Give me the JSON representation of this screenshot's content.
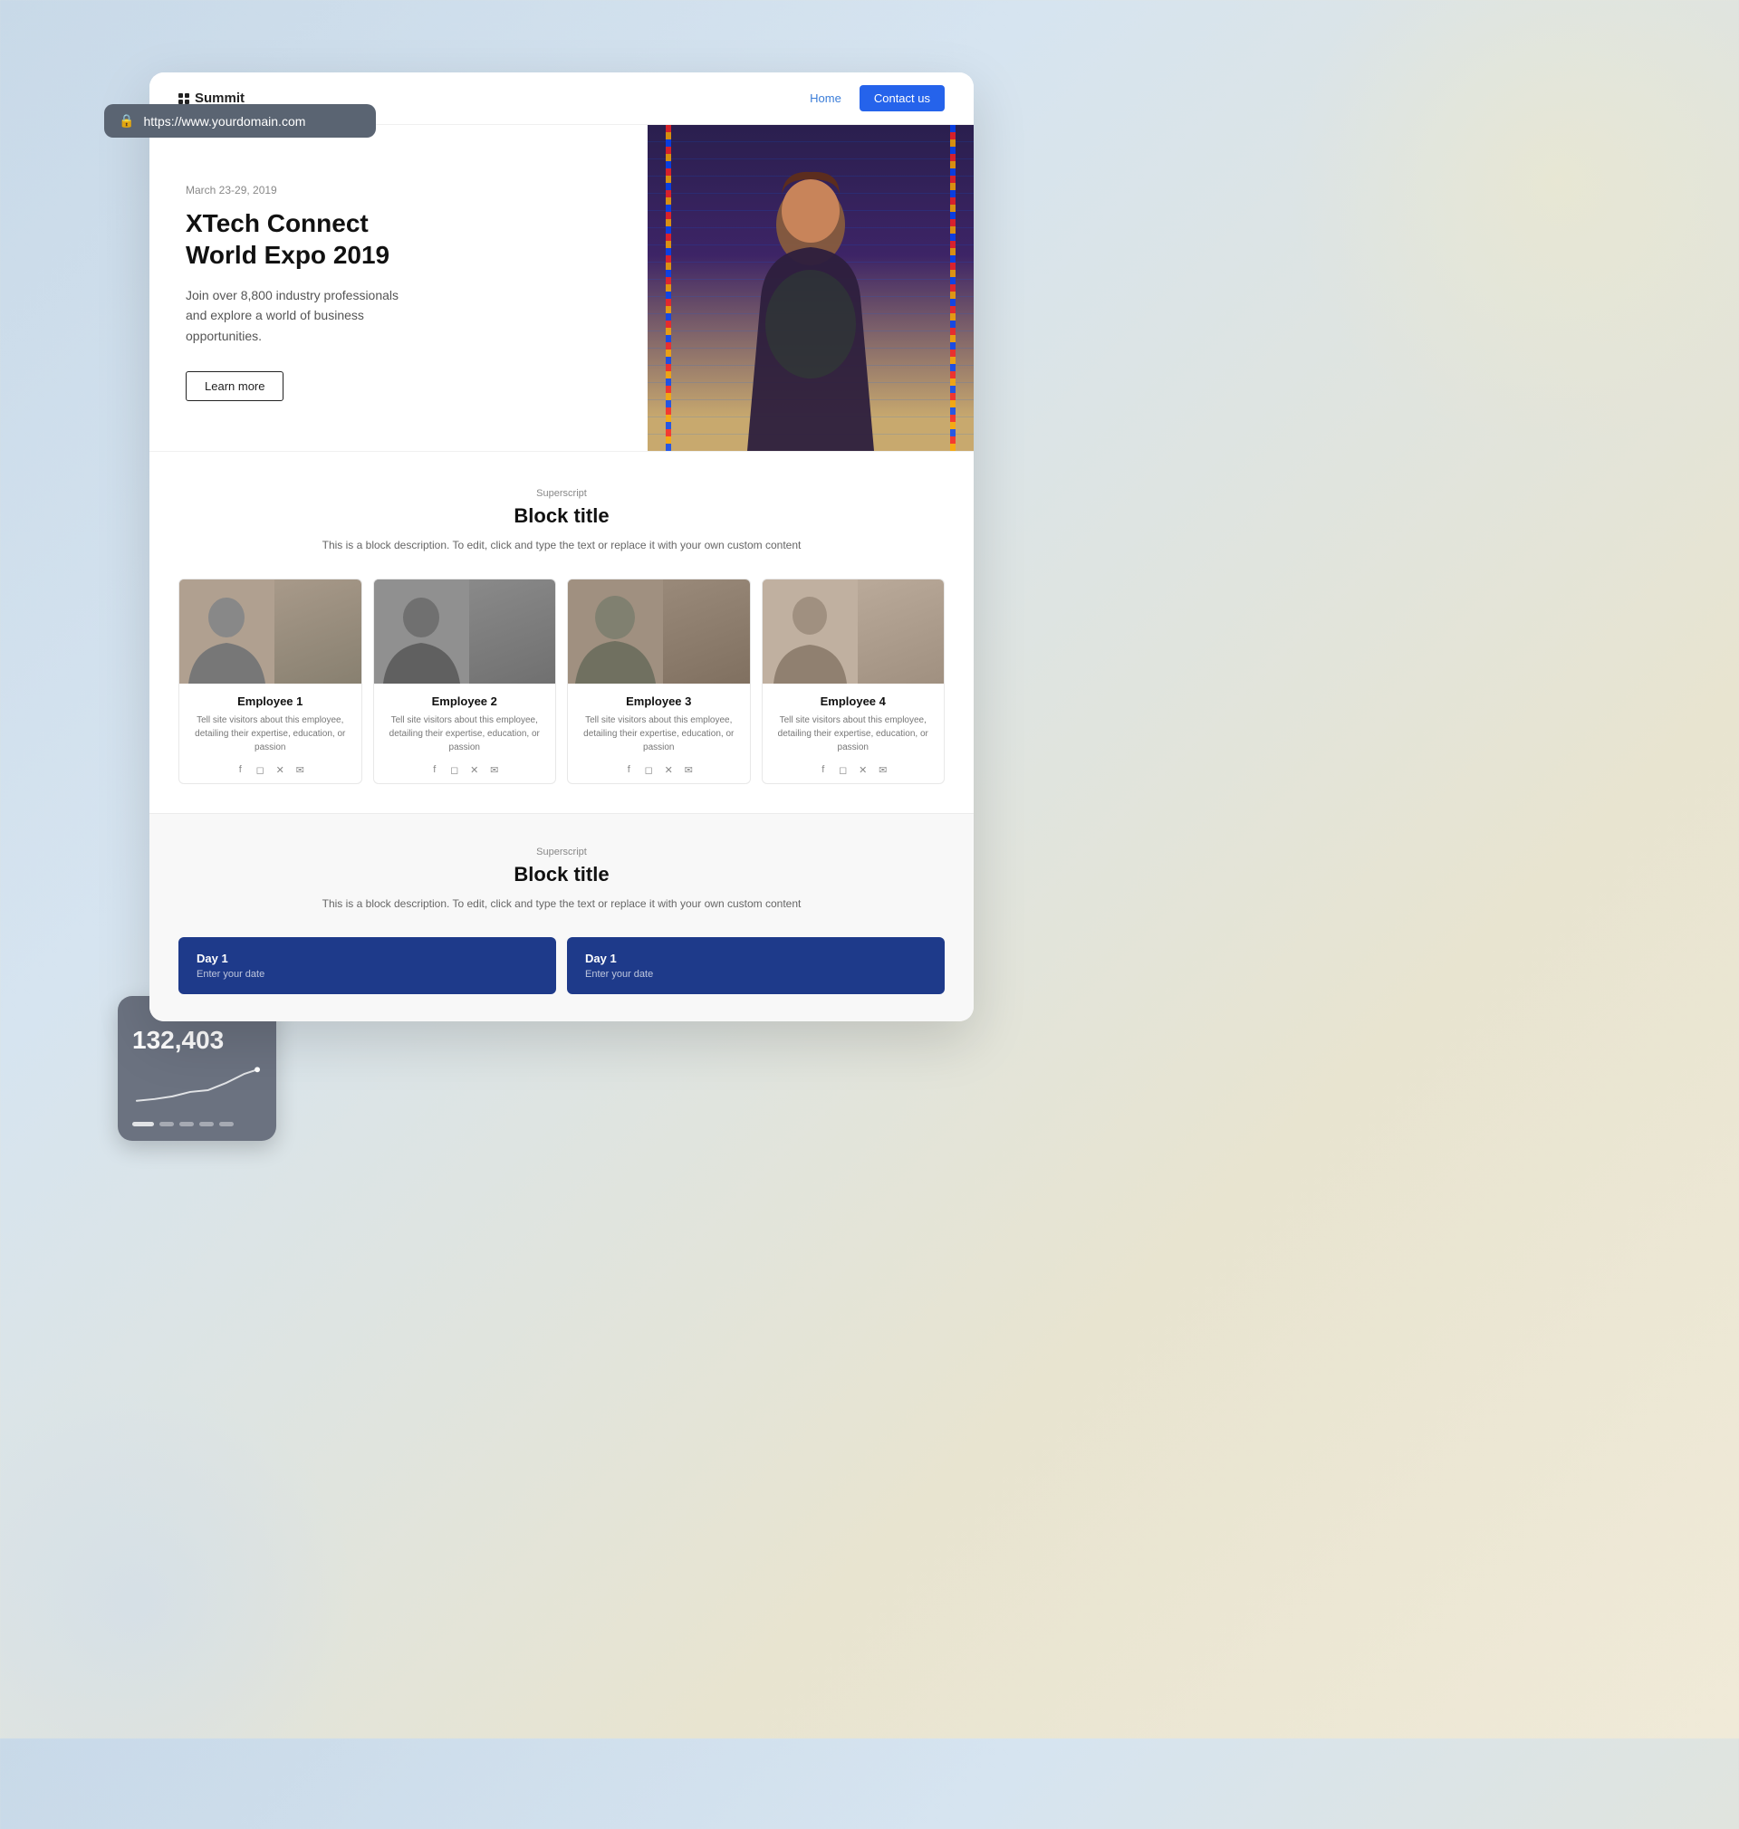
{
  "background": {
    "gradient_start": "#c8d9e8",
    "gradient_end": "#f0ead8"
  },
  "address_bar": {
    "url": "https://www.yourdomain.com",
    "lock_icon": "🔒"
  },
  "site_nav": {
    "logo_text": "Summit",
    "home_link": "Home",
    "contact_btn": "Contact us"
  },
  "hero": {
    "date": "March 23-29, 2019",
    "title_line1": "XTech Connect",
    "title_line2": "World Expo 2019",
    "description": "Join over 8,800 industry professionals and explore a world of business opportunities.",
    "cta_button": "Learn more"
  },
  "block_section_1": {
    "superscript": "Superscript",
    "title": "Block title",
    "description": "This is a block description. To edit, click and type the text or replace it with your own custom content",
    "employees": [
      {
        "name": "Employee 1",
        "bio": "Tell site visitors about this employee, detailing their expertise, education, or passion"
      },
      {
        "name": "Employee 2",
        "bio": "Tell site visitors about this employee, detailing their expertise, education, or passion"
      },
      {
        "name": "Employee 3",
        "bio": "Tell site visitors about this employee, detailing their expertise, education, or passion"
      },
      {
        "name": "Employee 4",
        "bio": "Tell site visitors about this employee, detailing their expertise, education, or passion"
      }
    ],
    "social_icons": [
      "f",
      "◻",
      "✕",
      "✉"
    ]
  },
  "block_section_2": {
    "superscript": "Superscript",
    "title": "Block title",
    "description": "This is a block description. To edit, click and type the text or replace it with your own custom content",
    "schedule_cards": [
      {
        "title": "Day 1",
        "subtitle": "Enter your date"
      },
      {
        "title": "Day 1",
        "subtitle": "Enter your date"
      }
    ]
  },
  "analytics_widget": {
    "number": "132,403",
    "chart_label": "Growth chart"
  },
  "shield_badge": {
    "icon": "✓"
  }
}
